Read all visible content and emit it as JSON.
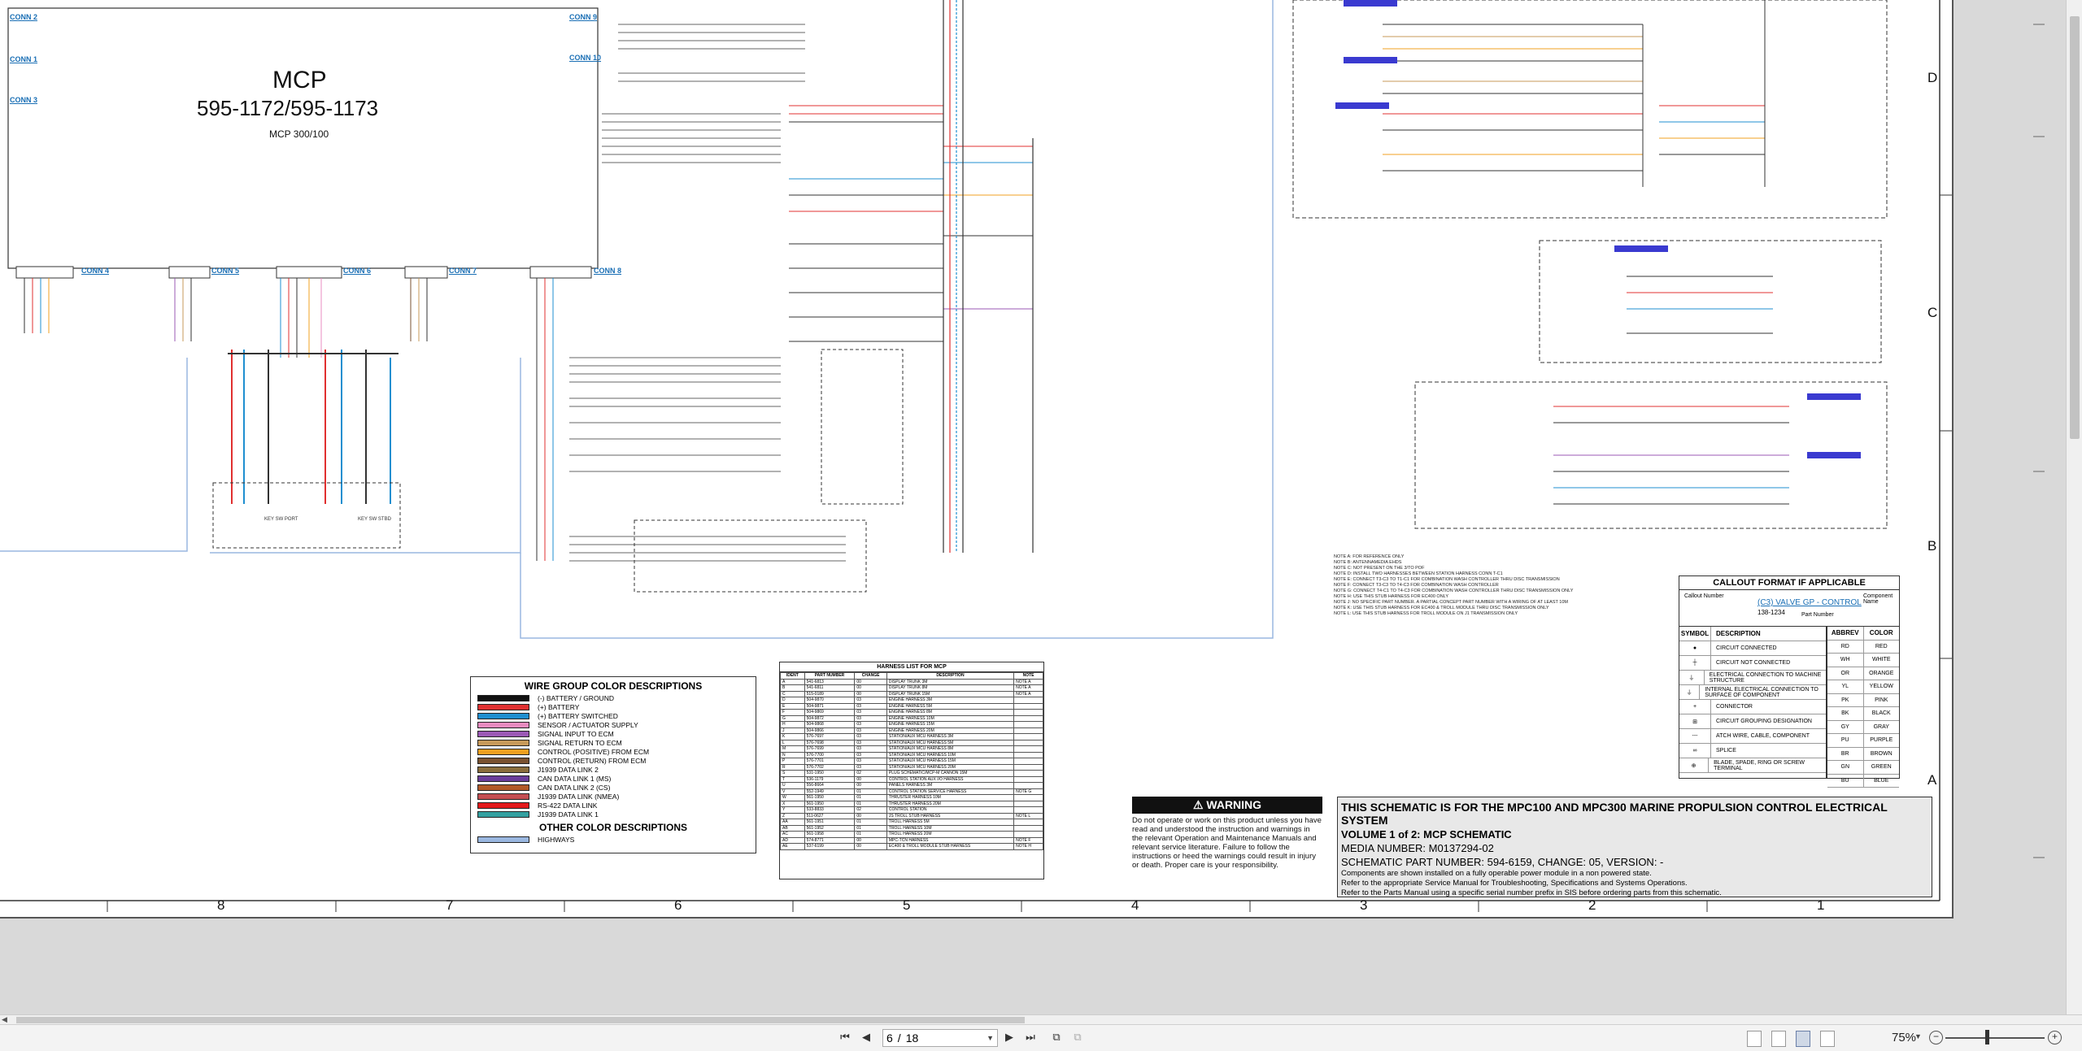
{
  "schematic": {
    "mcp_title": "MCP",
    "mcp_part": "595-1172/595-1173",
    "mcp_sub": "MCP 300/100",
    "connectors": [
      "CONN 2",
      "CONN 1",
      "CONN 3",
      "CONN 4",
      "CONN 5",
      "CONN 6",
      "CONN 7",
      "CONN 8",
      "CONN 9",
      "CONN 10"
    ],
    "key_labels": [
      "KEY SW PORT",
      "KEY SW STBD"
    ],
    "zone_numbers": [
      "8",
      "7",
      "6",
      "5",
      "4",
      "3",
      "2",
      "1"
    ],
    "zone_letters": [
      "D",
      "C",
      "B",
      "A"
    ]
  },
  "wire_legend": {
    "title": "WIRE GROUP COLOR DESCRIPTIONS",
    "items": [
      {
        "label": "(-) BATTERY / GROUND",
        "color": "#111111"
      },
      {
        "label": "(+) BATTERY",
        "color": "#e03030"
      },
      {
        "label": "(+) BATTERY SWITCHED",
        "color": "#1f8fd0"
      },
      {
        "label": "SENSOR / ACTUATOR SUPPLY",
        "color": "#e88cc0"
      },
      {
        "label": "SIGNAL INPUT TO ECM",
        "color": "#9b59b6"
      },
      {
        "label": "SIGNAL RETURN TO ECM",
        "color": "#c79a5a"
      },
      {
        "label": "CONTROL (POSITIVE) FROM ECM",
        "color": "#f0a020"
      },
      {
        "label": "CONTROL (RETURN) FROM ECM",
        "color": "#7a5230"
      },
      {
        "label": "J1939 DATA LINK 2",
        "color": "#8a6d3b"
      },
      {
        "label": "CAN DATA LINK 1 (MS)",
        "color": "#6a3d9a"
      },
      {
        "label": "CAN DATA LINK 2 (CS)",
        "color": "#b15928"
      },
      {
        "label": "J1939 DATA LINK (NMEA)",
        "color": "#c44e52"
      },
      {
        "label": "RS-422 DATA LINK",
        "color": "#e31a1c"
      },
      {
        "label": "J1939 DATA LINK 1",
        "color": "#33a0a0"
      }
    ],
    "other_title": "OTHER COLOR DESCRIPTIONS",
    "other_items": [
      {
        "label": "HIGHWAYS",
        "color": "#9ab7e0"
      }
    ]
  },
  "harness_list": {
    "title": "HARNESS LIST FOR MCP",
    "headers": [
      "IDENT",
      "PART NUMBER",
      "CHANGE",
      "DESCRIPTION",
      "NOTE"
    ],
    "rows": [
      [
        "A",
        "541-6813",
        "00",
        "DISPLAY TRUNK 3M",
        "NOTE A"
      ],
      [
        "B",
        "541-6811",
        "00",
        "DISPLAY TRUNK 8M",
        "NOTE A"
      ],
      [
        "C",
        "515-0189",
        "00",
        "DISPLAY TRUNK 15M",
        "NOTE A"
      ],
      [
        "D",
        "504-9870",
        "03",
        "ENGINE HARNESS 3M",
        ""
      ],
      [
        "E",
        "504-9871",
        "03",
        "ENGINE HARNESS 5M",
        ""
      ],
      [
        "F",
        "504-9869",
        "03",
        "ENGINE HARNESS 8M",
        ""
      ],
      [
        "G",
        "504-9872",
        "03",
        "ENGINE HARNESS 10M",
        ""
      ],
      [
        "H",
        "504-9868",
        "03",
        "ENGINE HARNESS 15M",
        ""
      ],
      [
        "J",
        "504-9866",
        "03",
        "ENGINE HARNESS 20M",
        ""
      ],
      [
        "K",
        "576-7697",
        "03",
        "STATION/AUX MCU HARNESS 3M",
        ""
      ],
      [
        "L",
        "576-7698",
        "03",
        "STATION/AUX MCU HARNESS 5M",
        ""
      ],
      [
        "M",
        "576-7699",
        "03",
        "STATION/AUX MCU HARNESS 8M",
        ""
      ],
      [
        "N",
        "576-7700",
        "03",
        "STATION/AUX MCU HARNESS 10M",
        ""
      ],
      [
        "P",
        "576-7701",
        "03",
        "STATION/AUX MCU HARNESS 15M",
        ""
      ],
      [
        "R",
        "576-7702",
        "03",
        "STATION/AUX MCU HARNESS 20M",
        ""
      ],
      [
        "S",
        "531-1950",
        "02",
        "PLUG SCHEMATIC/MCP-M CANNON 15M",
        ""
      ],
      [
        "T",
        "536-1179",
        "00",
        "CONTROL STATION AUX I/O HARNESS",
        ""
      ],
      [
        "U",
        "556-8664",
        "00",
        "PANELS HARNESS 3M",
        ""
      ],
      [
        "V",
        "552-1949",
        "01",
        "CONTROL STATION SERVICE HARNESS",
        "NOTE G"
      ],
      [
        "W",
        "561-1950",
        "01",
        "THRUSTER HARNESS 10M",
        ""
      ],
      [
        "X",
        "561-1950",
        "01",
        "THRUSTER HARNESS 20M",
        ""
      ],
      [
        "Y",
        "533-8833",
        "02",
        "CONTROL STATION",
        ""
      ],
      [
        "Z",
        "511-0627",
        "00",
        "JS TROLL STUB HARNESS",
        "NOTE L"
      ],
      [
        "AA",
        "561-1951",
        "01",
        "TROLL HARNESS 5M",
        ""
      ],
      [
        "AB",
        "561-1952",
        "01",
        "TROLL HARNESS 10M",
        ""
      ],
      [
        "AC",
        "561-1958",
        "01",
        "TROLL HARNESS 20M",
        ""
      ],
      [
        "AD",
        "574-8771",
        "00",
        "MPC-TCN HARNESS",
        "NOTE F"
      ],
      [
        "AE",
        "537-6199",
        "00",
        "EC400 & TROLL MODULE STUB HARNESS",
        "NOTE H"
      ]
    ]
  },
  "warning": {
    "heading": "WARNING",
    "text": "Do not operate or work on this product unless you have read and understood the instruction and warnings in the relevant Operation and Maintenance Manuals and relevant service literature. Failure to follow the instructions or heed the warnings could result in injury or death. Proper care is your responsibility."
  },
  "title_block": {
    "line1": "THIS SCHEMATIC IS FOR THE MPC100 AND MPC300 MARINE PROPULSION CONTROL ELECTRICAL SYSTEM",
    "line2": "VOLUME 1 of 2: MCP SCHEMATIC",
    "line3": "MEDIA NUMBER: M0137294-02",
    "line4": "SCHEMATIC PART NUMBER: 594-6159, CHANGE: 05, VERSION: -",
    "line5": "Components are shown installed on a fully operable power module in a non powered state.",
    "line6": "Refer to the appropriate Service Manual for Troubleshooting, Specifications and Systems Operations.",
    "line7": "Refer to the Parts Manual using a specific serial number prefix in SIS before ordering parts from this schematic."
  },
  "callout": {
    "title": "CALLOUT FORMAT IF APPLICABLE",
    "example": "(C3) VALVE GP - CONTROL",
    "example_part": "138-1234",
    "callout_number": "Callout Number",
    "component_name": "Component Name",
    "part_number": "Part Number"
  },
  "symbols": {
    "headers": [
      "SYMBOL",
      "DESCRIPTION"
    ],
    "rows": [
      [
        "●",
        "CIRCUIT CONNECTED"
      ],
      [
        "┼",
        "CIRCUIT NOT CONNECTED"
      ],
      [
        "⏚",
        "ELECTRICAL CONNECTION TO MACHINE STRUCTURE"
      ],
      [
        "⏚",
        "INTERNAL ELECTRICAL CONNECTION TO SURFACE OF COMPONENT"
      ],
      [
        "+",
        "CONNECTOR"
      ],
      [
        "⊞",
        "CIRCUIT GROUPING DESIGNATION"
      ],
      [
        "---",
        "ATCH WIRE, CABLE, COMPONENT"
      ],
      [
        "∞",
        "SPLICE"
      ],
      [
        "⊕",
        "BLADE, SPADE, RING OR SCREW TERMINAL"
      ]
    ]
  },
  "abbrev": {
    "headers": [
      "ABBREV",
      "COLOR"
    ],
    "rows": [
      [
        "RD",
        "RED"
      ],
      [
        "WH",
        "WHITE"
      ],
      [
        "OR",
        "ORANGE"
      ],
      [
        "YL",
        "YELLOW"
      ],
      [
        "PK",
        "PINK"
      ],
      [
        "BK",
        "BLACK"
      ],
      [
        "GY",
        "GRAY"
      ],
      [
        "PU",
        "PURPLE"
      ],
      [
        "BR",
        "BROWN"
      ],
      [
        "GN",
        "GREEN"
      ],
      [
        "BU",
        "BLUE"
      ]
    ]
  },
  "notes": [
    "NOTE A: FOR REFERENCE ONLY",
    "NOTE B: ANTENNAMEDIA EHDS",
    "NOTE C: NOT PRESENT ON THE 3/TO POF",
    "NOTE D: INSTALL TWO HARNESSES BETWEEN STATION HARNESS CONN T-C1",
    "NOTE E: CONNECT T3-C3 TO T1-C1 FOR COMBINATION WASH CONTROLLER THRU DISC TRANSMISSION",
    "NOTE F: CONNECT T3-C3 TO T4-C3 FOR COMBINATION WASH CONTROLLER",
    "NOTE G: CONNECT T4-C1 TO T4-C3 FOR COMBINATION WASH CONTROLLER THRU DISC TRANSMISSION ONLY",
    "NOTE H: USE THIS STUB HARNESS FOR EC400 ONLY",
    "NOTE J: NO SPECIFIC PART NUMBER. A PARTIAL CONCEPT PART NUMBER WITH A WIRING OF AT LEAST 10M",
    "NOTE K: USE THIS STUB HARNESS FOR EC400 & TROLL MODULE THRU DISC TRANSMISSION ONLY",
    "NOTE L: USE THIS STUB HARNESS FOR TROLL MODULE ON J1 TRANSMISSION ONLY"
  ],
  "status_bar": {
    "current_page": "6",
    "total_pages": "18",
    "page_separator": "/",
    "zoom": "75%"
  }
}
